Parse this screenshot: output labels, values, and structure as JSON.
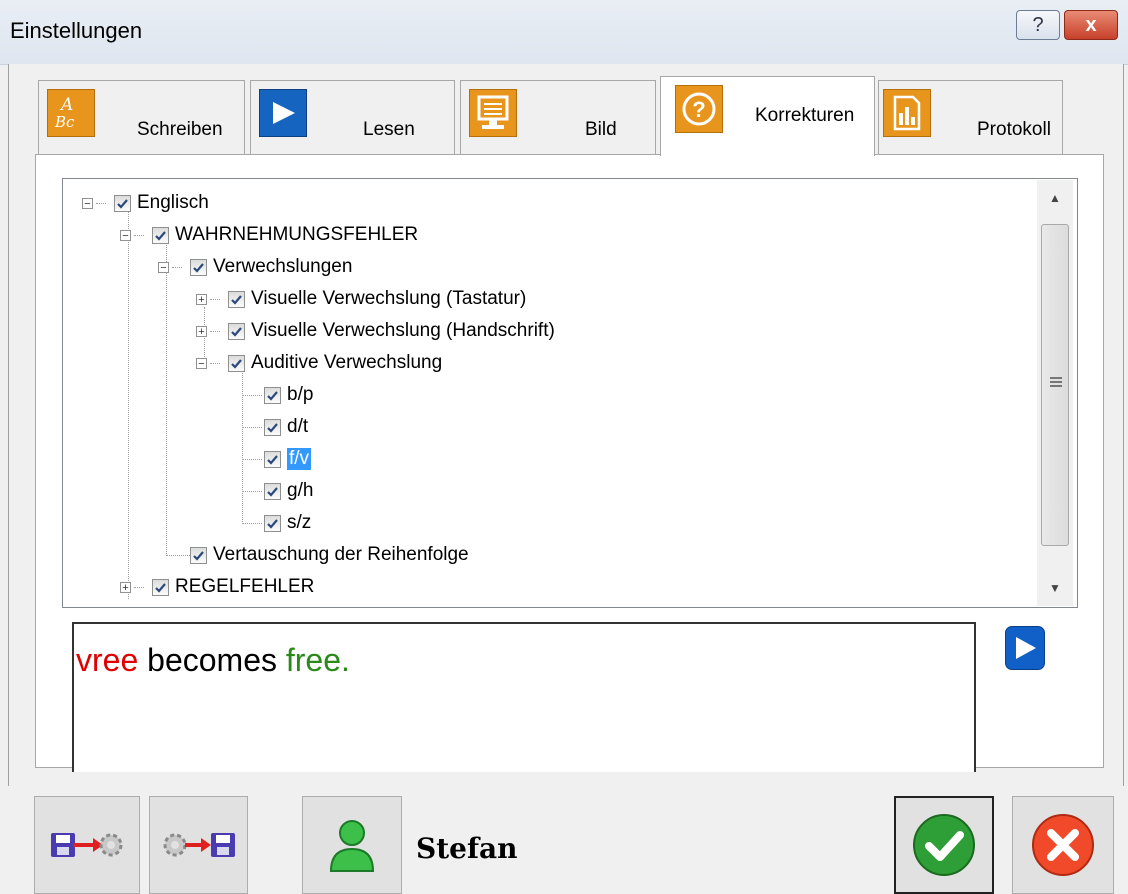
{
  "window": {
    "title": "Einstellungen",
    "help_label": "?",
    "close_label": "x"
  },
  "tabs": [
    {
      "label": "Schreiben",
      "icon": "abc-icon",
      "active": false
    },
    {
      "label": "Lesen",
      "icon": "play-icon",
      "active": false
    },
    {
      "label": "Bild",
      "icon": "monitor-icon",
      "active": false
    },
    {
      "label": "Korrekturen",
      "icon": "question-icon",
      "active": true
    },
    {
      "label": "Protokoll",
      "icon": "chart-icon",
      "active": false
    }
  ],
  "tree": {
    "root": "Englisch",
    "category1": "WAHRNEHMUNGSFEHLER",
    "group": "Verwechslungen",
    "visual_keyboard": "Visuelle Verwechslung (Tastatur)",
    "visual_handwriting": "Visuelle Verwechslung (Handschrift)",
    "auditory": "Auditive Verwechslung",
    "pairs": [
      "b/p",
      "d/t",
      "f/v",
      "g/h",
      "s/z"
    ],
    "selected_pair": "f/v",
    "order": "Vertauschung der Reihenfolge",
    "category2": "REGELFEHLER"
  },
  "example": {
    "wrong": "vree",
    "middle": "becomes",
    "right": "free."
  },
  "user": {
    "name": "Stefan"
  },
  "colors": {
    "accent": "#3399ff",
    "tab_icon_orange": "#e8951e",
    "tab_icon_blue": "#1565c0",
    "wrong": "#e00000",
    "right": "#2a8a18"
  }
}
